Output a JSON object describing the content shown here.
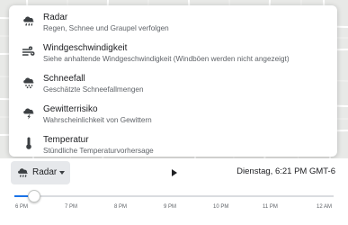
{
  "layer_menu": {
    "items": [
      {
        "title": "Radar",
        "description": "Regen, Schnee und Graupel verfolgen",
        "icon": "radar-cloud-icon"
      },
      {
        "title": "Windgeschwindigkeit",
        "description": "Siehe anhaltende Windgeschwindigkeit (Windböen werden nicht angezeigt)",
        "icon": "wind-icon"
      },
      {
        "title": "Schneefall",
        "description": "Geschätzte Schneefallmengen",
        "icon": "snow-cloud-icon"
      },
      {
        "title": "Gewitterrisiko",
        "description": "Wahrscheinlichkeit von Gewittern",
        "icon": "thunder-cloud-icon"
      },
      {
        "title": "Temperatur",
        "description": "Stündliche Temperaturvorhersage",
        "icon": "thermometer-icon"
      }
    ]
  },
  "controls": {
    "layer_label": "Radar",
    "time_label": "Dienstag, 6:21 PM GMT-6",
    "slider_position": 0.02,
    "timeline_ticks": [
      "6 PM",
      "7 PM",
      "8 PM",
      "9 PM",
      "10 PM",
      "11 PM",
      "12 AM"
    ]
  },
  "colors": {
    "accent": "#1a73e8",
    "icon": "#3c4043"
  }
}
